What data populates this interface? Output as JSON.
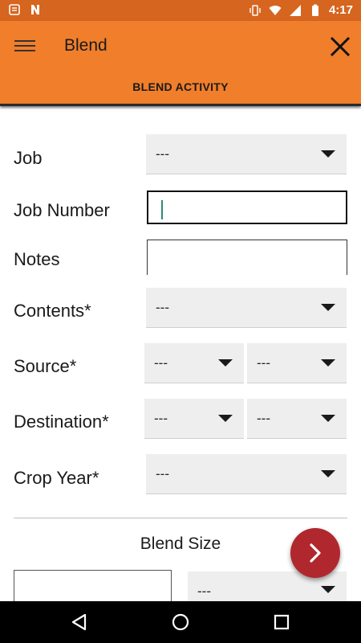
{
  "status_bar": {
    "time": "4:17",
    "left_icons": [
      "notes-icon",
      "notification-n-icon"
    ],
    "right_icons": [
      "vibrate-icon",
      "wifi-icon",
      "signal-icon",
      "battery-icon"
    ]
  },
  "app_bar": {
    "title": "Blend",
    "tab": "BLEND ACTIVITY",
    "color": "#f07e2b"
  },
  "form": {
    "job": {
      "label": "Job",
      "value": "---"
    },
    "job_number": {
      "label": "Job Number",
      "value": ""
    },
    "notes": {
      "label": "Notes",
      "value": ""
    },
    "contents": {
      "label": "Contents*",
      "value": "---"
    },
    "source": {
      "label": "Source*",
      "value_a": "---",
      "value_b": "---"
    },
    "destination": {
      "label": "Destination*",
      "value_a": "---",
      "value_b": "---"
    },
    "crop_year": {
      "label": "Crop Year*",
      "value": "---"
    }
  },
  "blend_size": {
    "title": "Blend Size",
    "amount": "",
    "unit": "---"
  },
  "fab": {
    "icon": "chevron-right-icon",
    "color": "#b0282e"
  },
  "nav_bar": {
    "icons": [
      "back-icon",
      "home-icon",
      "recents-icon"
    ]
  }
}
